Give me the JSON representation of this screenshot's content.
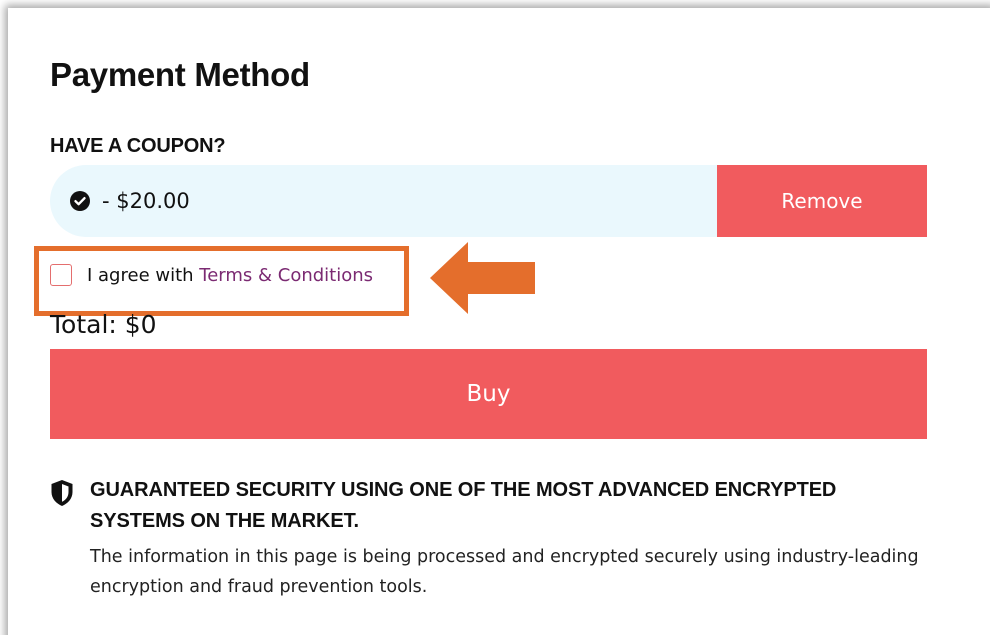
{
  "page": {
    "title": "Payment Method"
  },
  "coupon": {
    "label": "HAVE A COUPON?",
    "value": "- $20.00",
    "remove_label": "Remove",
    "icon": "check-circle-icon"
  },
  "terms": {
    "prefix": "I agree with ",
    "link_text": "Terms & Conditions",
    "checked": false
  },
  "order": {
    "total_label": "Total: $0",
    "buy_label": "Buy"
  },
  "security": {
    "icon": "shield-icon",
    "heading": "GUARANTEED SECURITY USING ONE OF THE MOST ADVANCED ENCRYPTED SYSTEMS ON THE MARKET.",
    "description": "The information in this page is being processed and encrypted securely using industry-leading encryption and fraud prevention tools."
  },
  "colors": {
    "accent": "#f15b5e",
    "coupon_bg": "#eaf8fd",
    "link": "#7b2a72",
    "annotation": "#e46e2c"
  }
}
